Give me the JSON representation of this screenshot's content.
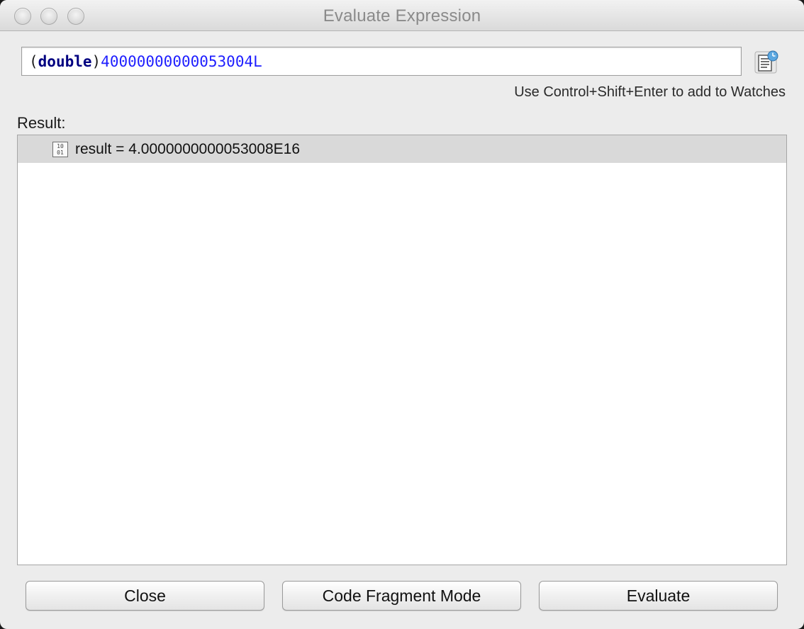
{
  "window": {
    "title": "Evaluate Expression"
  },
  "expression": {
    "open_paren": "(",
    "type_keyword": "double",
    "close_paren": ")",
    "literal": "40000000000053004L"
  },
  "history_button": {
    "icon": "history-dropdown-icon"
  },
  "hint": "Use Control+Shift+Enter to add to Watches",
  "result": {
    "label": "Result:",
    "rows": [
      {
        "icon": "primitive-value-icon",
        "icon_text": "10 01",
        "text": "result = 4.0000000000053008E16"
      }
    ]
  },
  "buttons": {
    "close": "Close",
    "mode": "Code Fragment Mode",
    "evaluate": "Evaluate"
  }
}
